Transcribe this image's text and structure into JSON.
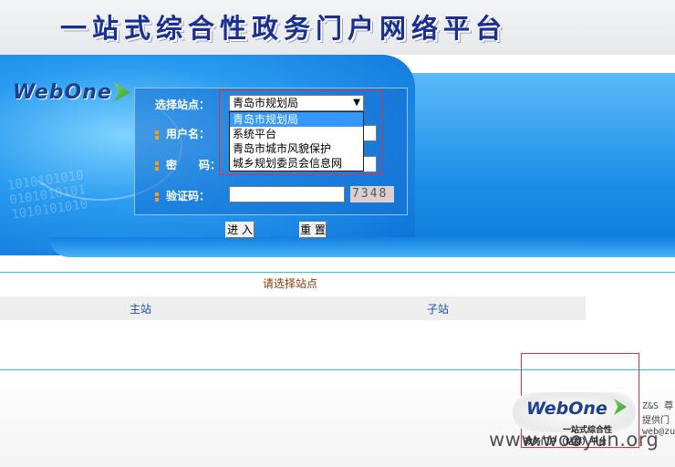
{
  "header": {
    "title": "一站式综合性政务门户网络平台"
  },
  "brand": {
    "logo_text": "WebOne"
  },
  "decor": {
    "binary_text": "1010101010\n0101010101\n1010101010"
  },
  "login": {
    "site_label": "选择站点：",
    "username_label": "用户名：",
    "password_label": "密　　码：",
    "captcha_label": "验证码：",
    "site_select": {
      "selected": "青岛市规划局",
      "options": [
        "青岛市规划局",
        "系统平台",
        "青岛市城市风貌保护",
        "城乡规划委员会信息网"
      ],
      "highlighted_index": 0
    },
    "captcha_value": "7348",
    "submit_label": "进 入",
    "reset_label": "重 置"
  },
  "sites": {
    "prompt": "请选择站点",
    "main_label": "主站",
    "sub_label": "子站"
  },
  "footer": {
    "logo_text": "WebOne",
    "tagline_1": "一站式综合性",
    "tagline_2": "政务门户（站群）平台",
    "side_line_1": "Z&S 尊",
    "side_line_2": "提供门",
    "side_line_3": "web@zu",
    "watermark": "www.wooyun.org"
  },
  "colors": {
    "title": "#1b2f8f",
    "banner": "#1d8ee8",
    "accent_rule": "#3bb8d6",
    "highlight": "#e0303a"
  }
}
